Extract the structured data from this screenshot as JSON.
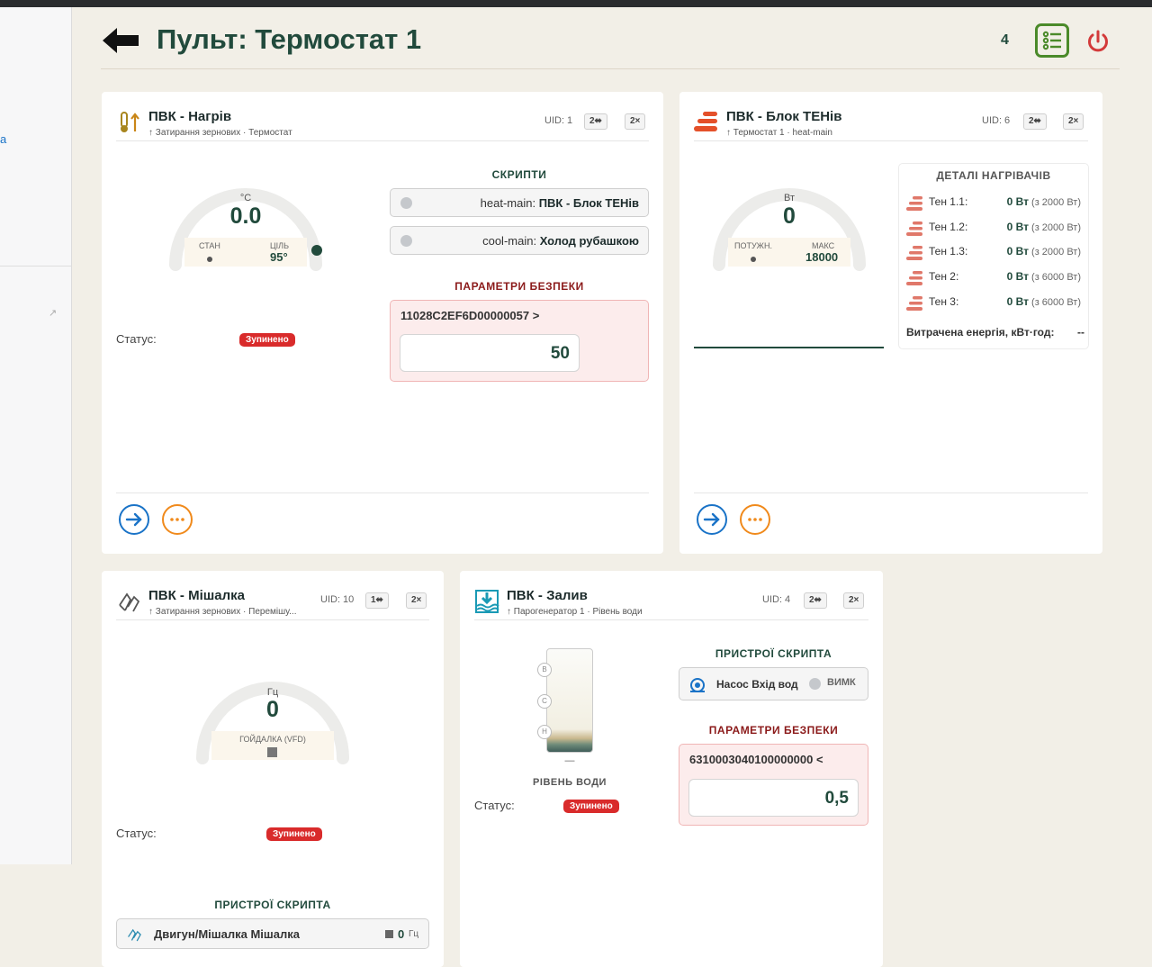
{
  "sidebar": {
    "link_fragment": "а",
    "arrow": "↗"
  },
  "header": {
    "title": "Пульт: Термостат 1",
    "count": "4"
  },
  "cards": {
    "heating": {
      "name": "ПВК - Нагрів",
      "subtitle": "↑ Затирання зернових · Термостат",
      "uid": "UID: 1",
      "btn1": "2⬌",
      "btn2": "2×",
      "gauge": {
        "unit": "°C",
        "value": "0.0",
        "state_label": "СТАН",
        "target_label": "ЦІЛЬ",
        "target_value": "95°"
      },
      "scripts_title": "СКРИПТИ",
      "scripts": [
        {
          "name": "heat-main:",
          "target": "ПВК - Блок ТЕНів"
        },
        {
          "name": "cool-main:",
          "target": "Холод рубашкою"
        }
      ],
      "safety_title": "ПАРАМЕТРИ БЕЗПЕКИ",
      "safety_code": "11028C2EF6D00000057 >",
      "safety_value": "50",
      "status_label": "Статус:",
      "status_value": "Зупинено"
    },
    "heaters": {
      "name": "ПВК - Блок ТЕНів",
      "subtitle": "↑ Термостат 1 · heat-main",
      "uid": "UID: 6",
      "btn1": "2⬌",
      "btn2": "2×",
      "gauge": {
        "unit": "Вт",
        "value": "0",
        "power_label": "ПОТУЖН.",
        "max_label": "МАКС",
        "max_value": "18000"
      },
      "details_title": "ДЕТАЛІ НАГРІВАЧІВ",
      "heaters": [
        {
          "name": "Тен 1.1:",
          "value": "0 Вт",
          "max": "(з 2000 Вт)"
        },
        {
          "name": "Тен 1.2:",
          "value": "0 Вт",
          "max": "(з 2000 Вт)"
        },
        {
          "name": "Тен 1.3:",
          "value": "0 Вт",
          "max": "(з 2000 Вт)"
        },
        {
          "name": "Тен 2:",
          "value": "0 Вт",
          "max": "(з 6000 Вт)"
        },
        {
          "name": "Тен 3:",
          "value": "0 Вт",
          "max": "(з 6000 Вт)"
        }
      ],
      "energy_label": "Витрачена енергія, кВт·год:",
      "energy_value": "--"
    },
    "mixer": {
      "name": "ПВК - Мішалка",
      "subtitle": "↑ Затирання зернових · Перемішу...",
      "uid": "UID: 10",
      "btn1": "1⬌",
      "btn2": "2×",
      "gauge": {
        "unit": "Гц",
        "value": "0",
        "mode_label": "ГОЙДАЛКА (VFD)"
      },
      "status_label": "Статус:",
      "status_value": "Зупинено",
      "devices_title": "ПРИСТРОЇ СКРИПТА",
      "device": {
        "name": "Двигун/Мішалка Мішалка",
        "value": "0",
        "unit": "Гц"
      }
    },
    "fill": {
      "name": "ПВК - Залив",
      "subtitle": "↑ Парогенератор 1 · Рівень води",
      "uid": "UID: 4",
      "btn1": "2⬌",
      "btn2": "2×",
      "tank_marks": [
        "В",
        "С",
        "Н"
      ],
      "tank_value": "—",
      "tank_label": "РІВЕНЬ ВОДИ",
      "status_label": "Статус:",
      "status_value": "Зупинено",
      "devices_title": "ПРИСТРОЇ СКРИПТА",
      "device": {
        "name": "Насос Вхід вод",
        "state": "ВИМК"
      },
      "safety_title": "ПАРАМЕТРИ БЕЗПЕКИ",
      "safety_code": "6310003040100000000 <",
      "safety_value": "0,5"
    }
  },
  "colors": {
    "primary": "#214a3c",
    "danger": "#d92b2b",
    "link": "#1a73c7",
    "accent_orange": "#f08a1c",
    "brand_green": "#4b8a2a"
  }
}
